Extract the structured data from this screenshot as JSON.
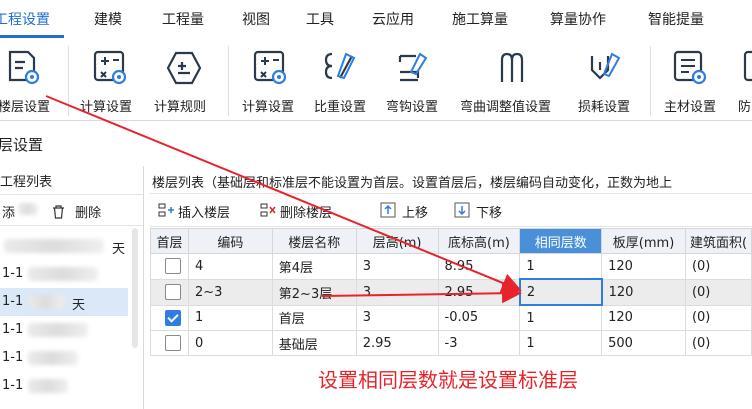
{
  "menu": {
    "items": [
      "工程设置",
      "建模",
      "工程量",
      "视图",
      "工具",
      "云应用",
      "施工算量",
      "算量协作",
      "智能提量"
    ],
    "active_index": 0
  },
  "ribbon": {
    "buttons": [
      {
        "label": "楼层设置",
        "icon": "floor-settings-icon"
      },
      {
        "label": "计算设置",
        "icon": "calc-settings-icon"
      },
      {
        "label": "计算规则",
        "icon": "calc-rules-icon"
      },
      {
        "label": "计算设置",
        "icon": "calc-settings-icon"
      },
      {
        "label": "比重设置",
        "icon": "density-settings-icon"
      },
      {
        "label": "弯钩设置",
        "icon": "hook-settings-icon"
      },
      {
        "label": "弯曲调整值设置",
        "icon": "bend-adjust-icon"
      },
      {
        "label": "损耗设置",
        "icon": "loss-settings-icon"
      },
      {
        "label": "主材设置",
        "icon": "material-settings-icon"
      },
      {
        "label": "防",
        "icon": "truncated-icon"
      }
    ]
  },
  "section_title": "层设置",
  "left_panel": {
    "title": "工程列表",
    "add_label": "添",
    "delete_label": "删除",
    "rows": [
      "",
      "1-1",
      "1-1",
      "1-1",
      "1-1",
      "1-1"
    ],
    "row_suffixes": [
      "天",
      "",
      "天",
      "",
      "",
      ""
    ]
  },
  "right_panel": {
    "description": "楼层列表（基础层和标准层不能设置为首层。设置首层后，楼层编码自动变化，正数为地上",
    "toolbar": {
      "insert_label": "插入楼层",
      "delete_label": "删除楼层",
      "up_label": "上移",
      "down_label": "下移"
    },
    "table": {
      "headers": [
        "首层",
        "编码",
        "楼层名称",
        "层高(m)",
        "底标高(m)",
        "相同层数",
        "板厚(mm)",
        "建筑面积("
      ],
      "rows": [
        {
          "first": false,
          "code": "4",
          "name": "第4层",
          "height": "3",
          "bottom": "8.95",
          "same": "1",
          "slab": "120",
          "area": "(0)"
        },
        {
          "first": false,
          "code": "2~3",
          "name": "第2~3层",
          "height": "3",
          "bottom": "2.95",
          "same": "2",
          "slab": "120",
          "area": "(0)"
        },
        {
          "first": true,
          "code": "1",
          "name": "首层",
          "height": "3",
          "bottom": "-0.05",
          "same": "1",
          "slab": "120",
          "area": "(0)"
        },
        {
          "first": false,
          "code": "0",
          "name": "基础层",
          "height": "2.95",
          "bottom": "-3",
          "same": "1",
          "slab": "500",
          "area": "(0)"
        }
      ]
    }
  },
  "annotation": {
    "text": "设置相同层数就是设置标准层",
    "color": "#e8232b"
  },
  "colors": {
    "accent": "#1f6fd1",
    "header_highlight": "#4a90d9",
    "arrow": "#e8232b"
  }
}
